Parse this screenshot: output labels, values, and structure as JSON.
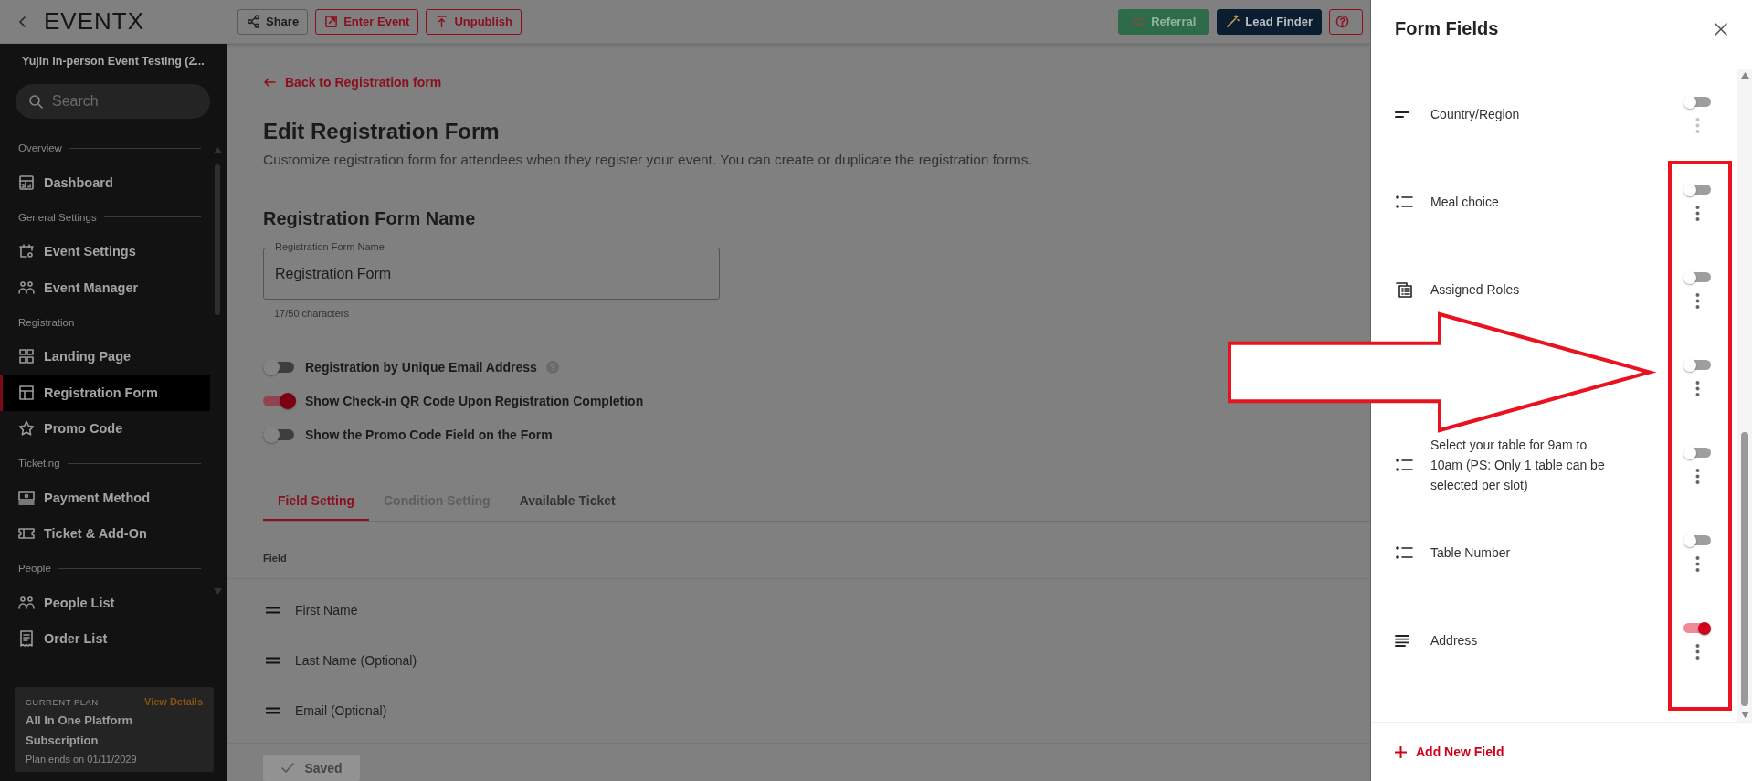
{
  "topbar": {
    "logo": "EVENTX",
    "buttons": [
      {
        "label": "Share",
        "kind": "share"
      },
      {
        "label": "Enter Event",
        "kind": "enter"
      },
      {
        "label": "Unpublish",
        "kind": "unpublish"
      },
      {
        "label": "Referral",
        "kind": "referral"
      },
      {
        "label": "Lead Finder",
        "kind": "finder"
      },
      {
        "kind": "help"
      }
    ]
  },
  "sidebar": {
    "event_name": "Yujin In-person Event Testing (2...",
    "search": {
      "placeholder": "Search"
    },
    "sections": [
      {
        "title": "Overview",
        "items": [
          {
            "label": "Dashboard",
            "kind": "dashboard",
            "selected": false
          }
        ]
      },
      {
        "title": "General Settings",
        "items": [
          {
            "label": "Event Settings",
            "kind": "settings",
            "selected": false
          },
          {
            "label": "Event Manager",
            "kind": "people",
            "selected": false
          }
        ]
      },
      {
        "title": "Registration",
        "items": [
          {
            "label": "Landing Page",
            "kind": "grid",
            "selected": false
          },
          {
            "label": "Registration Form",
            "kind": "table",
            "selected": true
          },
          {
            "label": "Promo Code",
            "kind": "star",
            "selected": false
          }
        ]
      },
      {
        "title": "Ticketing",
        "items": [
          {
            "label": "Payment Method",
            "kind": "cash",
            "selected": false
          },
          {
            "label": "Ticket & Add-On",
            "kind": "ticket",
            "selected": false
          }
        ]
      },
      {
        "title": "People",
        "items": [
          {
            "label": "People List",
            "kind": "people",
            "selected": false
          },
          {
            "label": "Order List",
            "kind": "receipt",
            "selected": false
          }
        ]
      }
    ],
    "plan": {
      "caption": "CURRENT PLAN",
      "link": "View Details",
      "name": "All In One Platform Subscription",
      "ends": "Plan ends on 01/11/2029"
    }
  },
  "main": {
    "back_link": "Back to Registration form",
    "title": "Edit Registration Form",
    "description": "Customize registration form for attendees when they register your event. You can create or duplicate the registration forms.",
    "name_section": "Registration Form Name",
    "name_field": {
      "label": "Registration Form Name",
      "value": "Registration Form",
      "counter": "17/50 characters"
    },
    "toggles": [
      {
        "label": "Registration by Unique Email Address",
        "on": false,
        "help": true
      },
      {
        "label": "Show Check-in QR Code Upon Registration Completion",
        "on": true,
        "help": false
      },
      {
        "label": "Show the Promo Code Field on the Form",
        "on": false,
        "help": false
      }
    ],
    "tabs": [
      {
        "label": "Field Setting",
        "selected": true,
        "disabled": false
      },
      {
        "label": "Condition Setting",
        "selected": false,
        "disabled": true
      },
      {
        "label": "Available Ticket",
        "selected": false,
        "disabled": false
      }
    ],
    "table": {
      "columns": [
        "Field"
      ],
      "rows": [
        "First Name",
        "Last Name (Optional)",
        "Email (Optional)"
      ]
    },
    "save_button": {
      "label": "Saved",
      "disabled": true
    }
  },
  "drawer": {
    "title": "Form Fields",
    "fields": [
      {
        "label": "Country/Region",
        "kind": "text",
        "on": false,
        "menu_disabled": true
      },
      {
        "label": "Meal choice",
        "kind": "choice",
        "on": false,
        "menu_disabled": false
      },
      {
        "label": "Assigned Roles",
        "kind": "roles",
        "on": false,
        "menu_disabled": false
      },
      {
        "on": false,
        "menu_disabled": false
      },
      {
        "label": "Select your table for 9am to 10am (PS: Only 1 table can be selected per slot)",
        "kind": "choice",
        "on": false,
        "menu_disabled": false
      },
      {
        "label": "Table Number",
        "kind": "choice",
        "on": false,
        "menu_disabled": false
      },
      {
        "label": "Address",
        "kind": "paragraph",
        "on": true,
        "menu_disabled": false
      }
    ],
    "add_button": "Add New Field"
  },
  "annotations": [
    {
      "kind": "arrow"
    },
    {
      "kind": "frame"
    }
  ]
}
